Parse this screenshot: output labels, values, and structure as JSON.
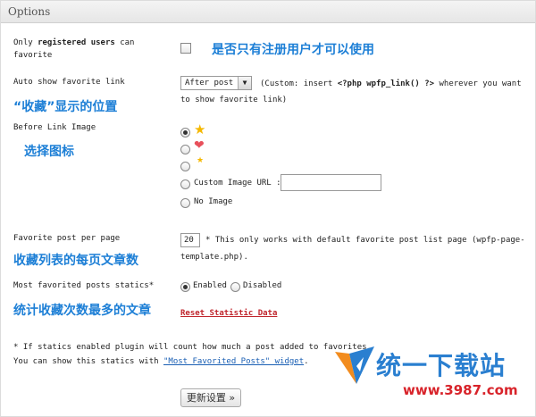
{
  "header": {
    "title": "Options"
  },
  "registered_only": {
    "label_pre": "Only ",
    "label_bold": "registered users",
    "label_post": " can",
    "label_line2": "favorite",
    "annotation": "是否只有注册用户才可以使用"
  },
  "auto_show": {
    "label": "Auto show favorite link",
    "selected": "After post",
    "hint_pre": "(Custom: insert ",
    "hint_code": "<?php wpfp_link() ?>",
    "hint_post": " wherever you want",
    "hint_line2": "to show favorite link)",
    "annotation": "“收藏”显示的位置"
  },
  "link_image": {
    "label": "Before Link Image",
    "annotation": "选择图标",
    "custom_label": "Custom Image URL :",
    "no_image_label": "No Image",
    "icons": [
      "star-icon",
      "heart-icon",
      "small-star-icon"
    ]
  },
  "per_page": {
    "label": "Favorite post per page",
    "value": "20",
    "hint": "* This only works with default favorite post list page (wpfp-page-",
    "hint_line2": "template.php).",
    "annotation": "收藏列表的每页文章数"
  },
  "statics": {
    "label": "Most favorited posts statics*",
    "enabled_label": "Enabled",
    "disabled_label": "Disabled",
    "annotation": "统计收藏次数最多的文章",
    "reset_label": "Reset Statistic Data"
  },
  "footnote": {
    "line1": "* If statics enabled plugin will count how much a post added to favorites.",
    "line2_pre": "You can show this statics with ",
    "widget_link": "\"Most Favorited Posts\" widget",
    "line2_post": "."
  },
  "save_button": {
    "label": "更新设置 »"
  },
  "watermark": {
    "brand": "统一下载站",
    "url": "www.3987.com"
  },
  "colors": {
    "annotation": "#1d7fd6",
    "reset_link": "#c0262d",
    "star": "#f5b800",
    "heart": "#e8505b"
  }
}
